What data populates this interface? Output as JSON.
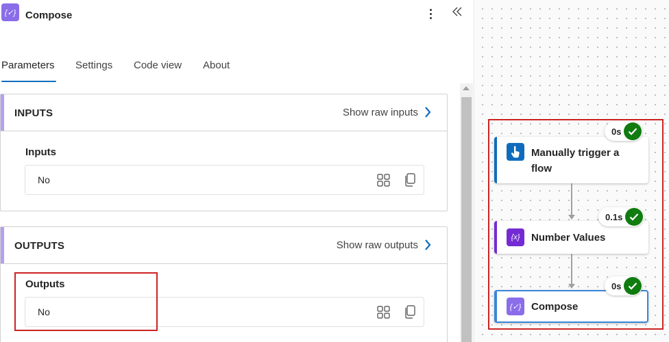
{
  "header": {
    "title": "Compose",
    "icon_glyph": "{✓}"
  },
  "tabs": [
    {
      "label": "Parameters",
      "active": true
    },
    {
      "label": "Settings",
      "active": false
    },
    {
      "label": "Code view",
      "active": false
    },
    {
      "label": "About",
      "active": false
    }
  ],
  "inputs_section": {
    "title": "INPUTS",
    "raw_link": "Show raw inputs",
    "field_label": "Inputs",
    "field_value": "No"
  },
  "outputs_section": {
    "title": "OUTPUTS",
    "raw_link": "Show raw outputs",
    "field_label": "Outputs",
    "field_value": "No"
  },
  "flow": {
    "nodes": [
      {
        "label_line1": "Manually trigger a",
        "label_line2": "flow",
        "duration": "0s",
        "icon": "hand-pointer-icon"
      },
      {
        "label": "Number Values",
        "duration": "0.1s",
        "icon": "variable-icon",
        "icon_glyph": "{x}"
      },
      {
        "label": "Compose",
        "duration": "0s",
        "icon": "compose-icon",
        "icon_glyph": "{✓}"
      }
    ]
  },
  "colors": {
    "accent": "#0f6cbd",
    "compose_icon": "#8a6de9",
    "variable_icon": "#742bd4",
    "success": "#107c10",
    "highlight": "#cc2222"
  }
}
